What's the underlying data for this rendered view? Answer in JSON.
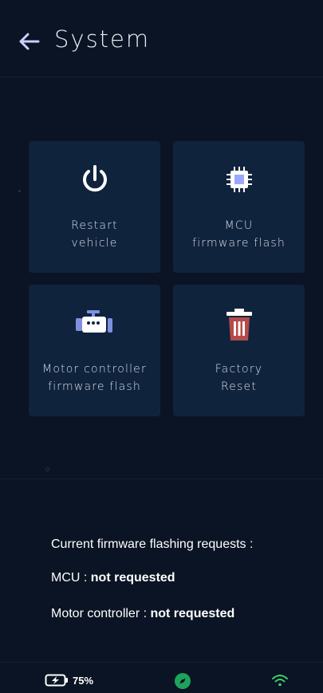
{
  "header": {
    "title": "System"
  },
  "tiles": [
    {
      "label": "Restart\nvehicle",
      "icon": "power-icon"
    },
    {
      "label": "MCU\nfirmware flash",
      "icon": "chip-icon"
    },
    {
      "label": "Motor controller\nfirmware flash",
      "icon": "engine-icon"
    },
    {
      "label": "Factory\nReset",
      "icon": "trash-icon"
    }
  ],
  "info": {
    "heading": "Current firmware flashing requests :",
    "mcu_label": "MCU : ",
    "mcu_status": "not requested",
    "motor_label": "Motor controller : ",
    "motor_status": "not requested"
  },
  "status_bar": {
    "battery_percent": "75%",
    "colors": {
      "compass": "#1ea35a",
      "wifi": "#3ccf6e",
      "trash": "#b54a4a",
      "accent_icon": "#9aa8ff"
    }
  }
}
